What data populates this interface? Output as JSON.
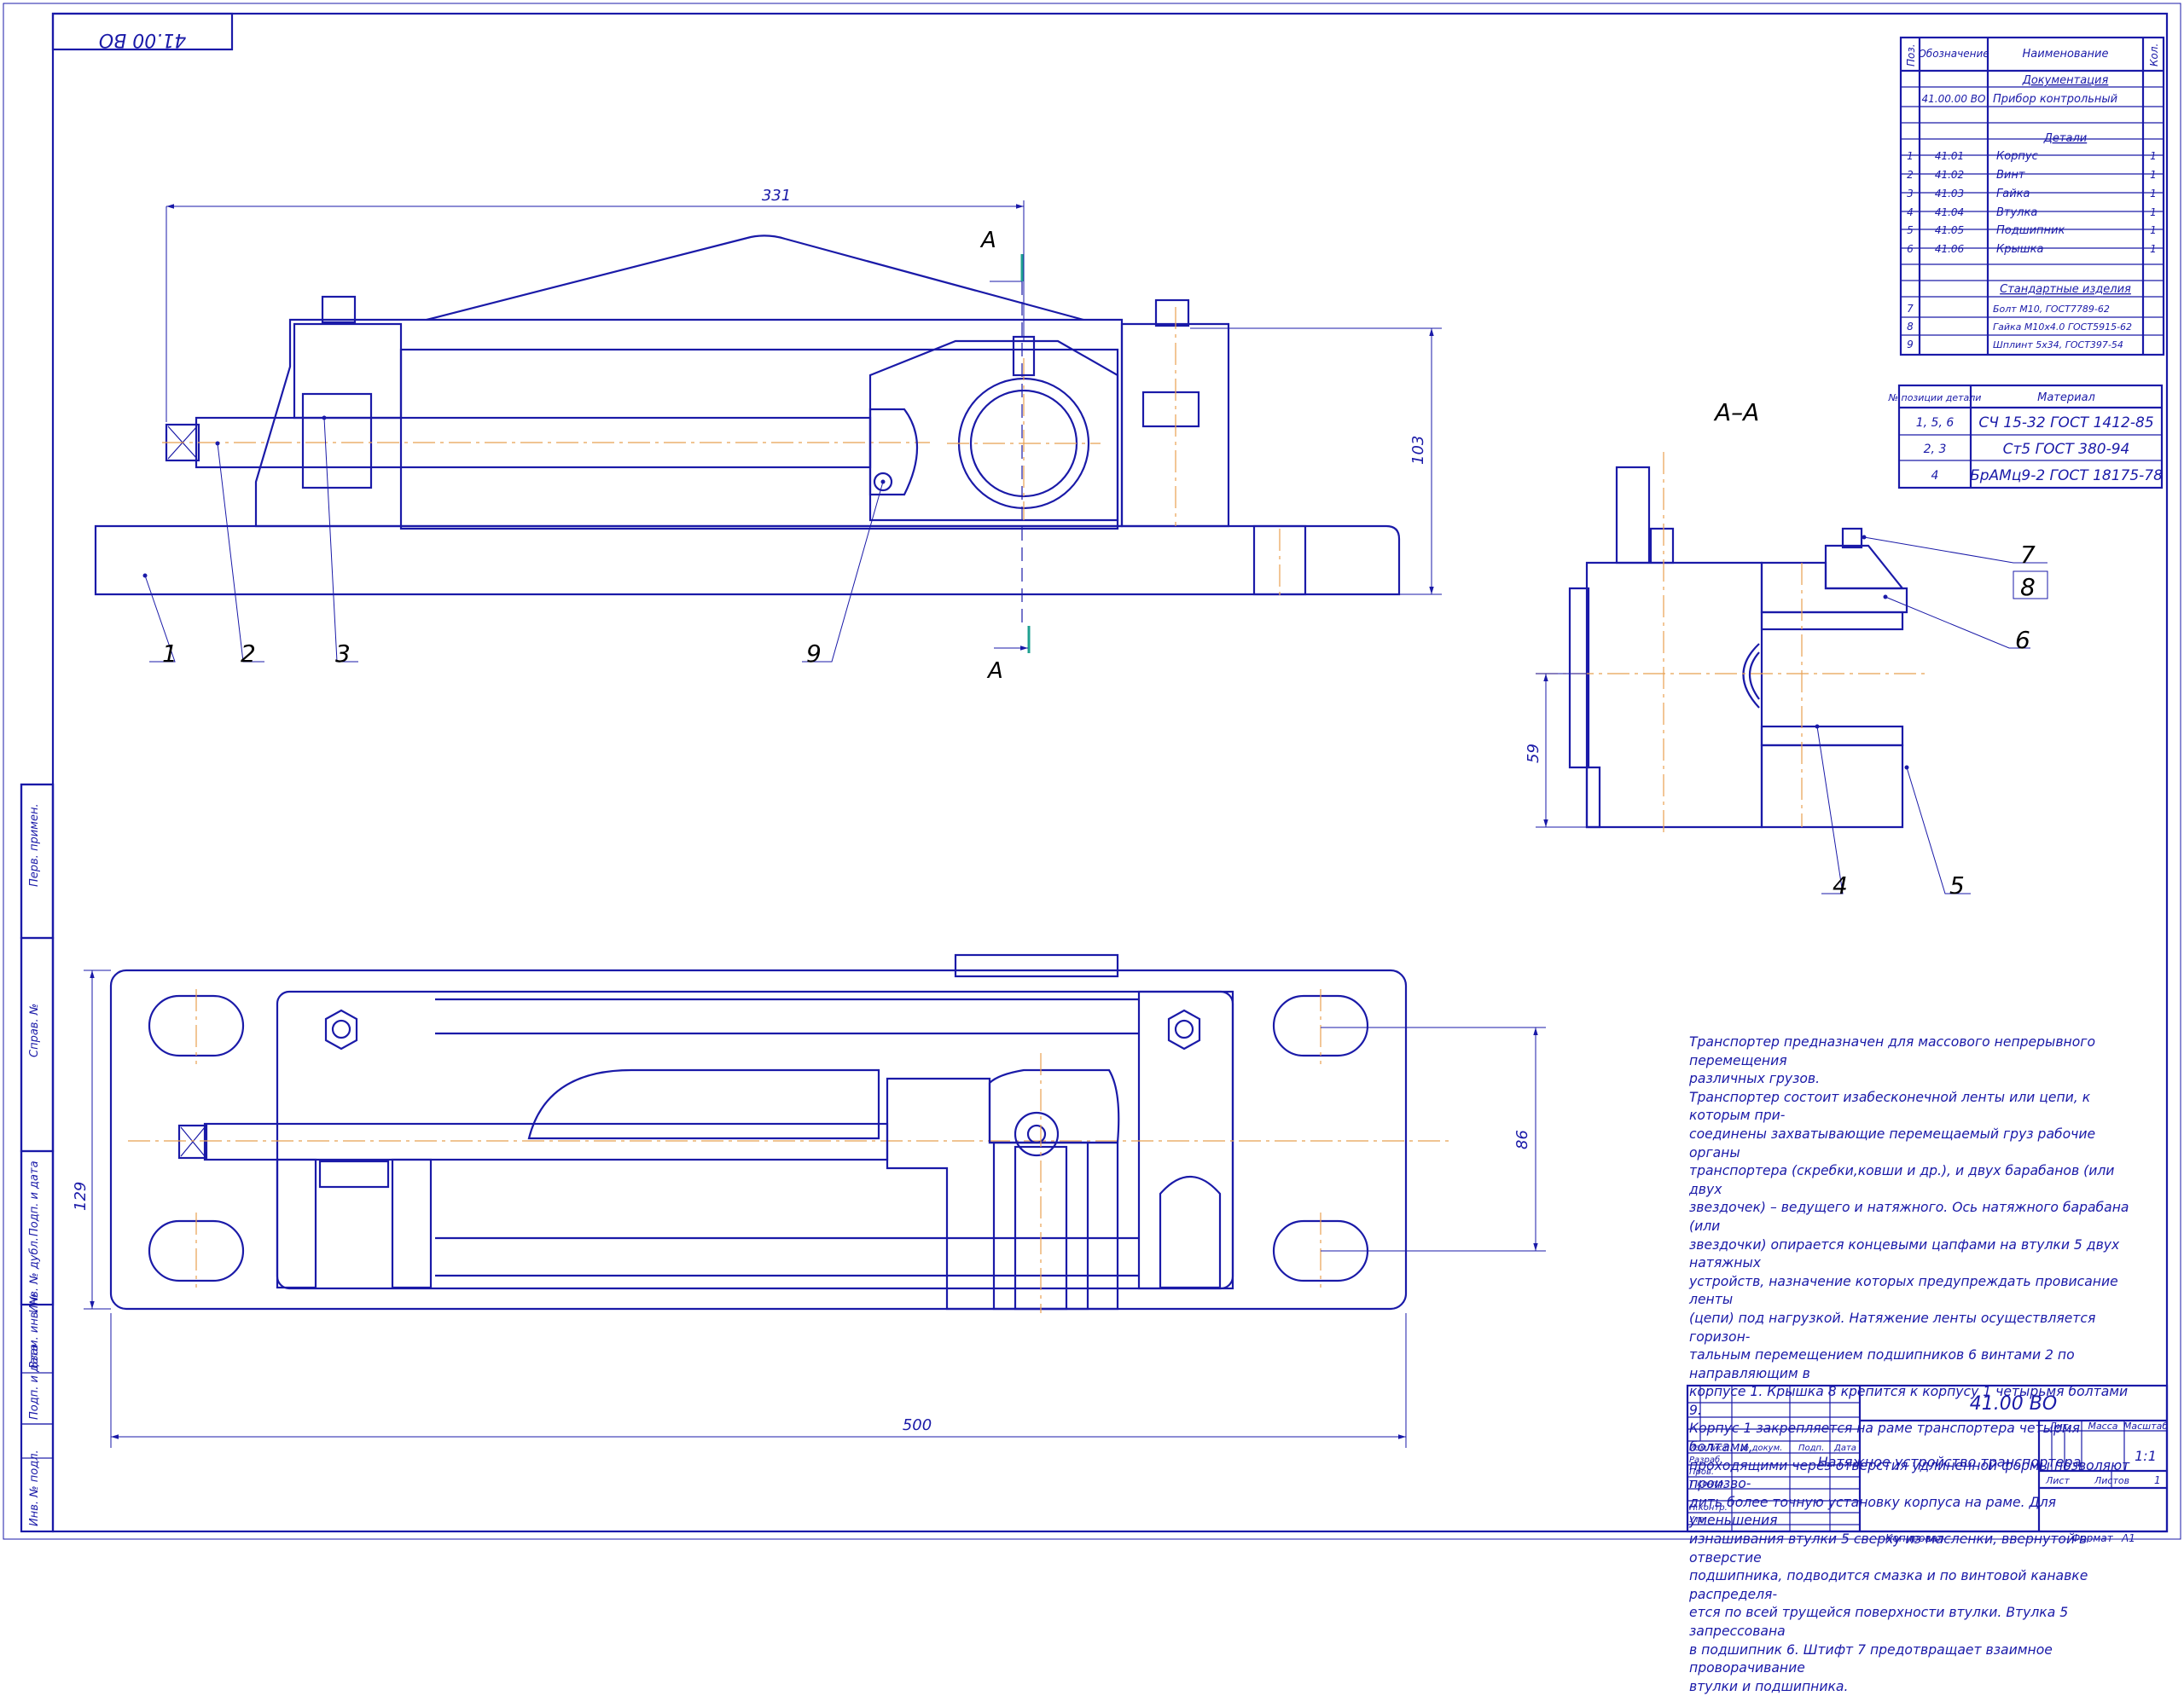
{
  "stamp_top": "41.00 ВО",
  "dimensions": {
    "d331": "331",
    "d103": "103",
    "d59": "59",
    "d129": "129",
    "d86": "86",
    "d500": "500"
  },
  "section_marks": {
    "a1": "А",
    "a2": "А",
    "view_title": "А–А"
  },
  "callouts": {
    "c1": "1",
    "c2": "2",
    "c3": "3",
    "c9": "9",
    "c4": "4",
    "c5": "5",
    "c6": "6",
    "c7": "7",
    "c8": "8"
  },
  "spec_table": {
    "headers": {
      "pos": "Поз.",
      "designation": "Обозначение",
      "name": "Наименование",
      "qty": "Кол."
    },
    "sections": {
      "docs": "Документация",
      "parts": "Детали",
      "std": "Стандартные изделия"
    },
    "doc_row": {
      "designation": "41.00.00 ВО",
      "name": "Прибор контрольный"
    },
    "rows": [
      {
        "pos": "1",
        "designation": "41.01",
        "name": "Корпус",
        "qty": "1"
      },
      {
        "pos": "2",
        "designation": "41.02",
        "name": "Винт",
        "qty": "1"
      },
      {
        "pos": "3",
        "designation": "41.03",
        "name": "Гайка",
        "qty": "1"
      },
      {
        "pos": "4",
        "designation": "41.04",
        "name": "Втулка",
        "qty": "1"
      },
      {
        "pos": "5",
        "designation": "41.05",
        "name": "Подшипник",
        "qty": "1"
      },
      {
        "pos": "6",
        "designation": "41.06",
        "name": "Крышка",
        "qty": "1"
      }
    ],
    "std_rows": [
      {
        "pos": "7",
        "name": "Болт М10, ГОСТ7789-62"
      },
      {
        "pos": "8",
        "name": "Гайка М10х4.0 ГОСТ5915-62"
      },
      {
        "pos": "9",
        "name": "Шплинт 5х34, ГОСТ397-54"
      }
    ]
  },
  "material_table": {
    "headers": {
      "pos": "№ позиции детали",
      "material": "Материал"
    },
    "rows": [
      {
        "pos": "1, 5, 6",
        "material": "СЧ 15-32 ГОСТ 1412-85"
      },
      {
        "pos": "2, 3",
        "material": "Ст5 ГОСТ 380-94"
      },
      {
        "pos": "4",
        "material": "БрАМц9-2 ГОСТ 18175-78"
      }
    ]
  },
  "note_lines": [
    "Транспортер предназначен для массового непрерывного перемещения",
    "различных грузов.",
    "Транспортер состоит изабесконечной ленты или цепи, к которым при-",
    "соединены захватывающие перемещаемый груз рабочие органы",
    "транспортера (скребки,ковши и др.), и двух барабанов (или двух",
    "звездочек) – ведущего и натяжного. Ось натяжного барабана (или",
    "звездочки) опирается концевыми цапфами на втулки 5 двух натяжных",
    "устройств, назначение которых предупреждать провисание ленты",
    "(цепи) под нагрузкой. Натяжение ленты осуществляется горизон-",
    "тальным перемещением подшипников 6 винтами 2 по направляющим в",
    "корпусе 1. Крышка 8 крепится к корпусу 1 четырьмя болтами 9.",
    "Корпус 1 закрепляется на раме транспортера четырмя болтами,",
    "проходящими через отверстия удлиненной формы позволяют произво-",
    "дить более точную установку корпуса на раме. Для уменьшения",
    "изнашивания втулки 5 сверху из масленки, ввернутой в отверстие",
    "подшипника, подводится смазка и по винтовой канавке распределя-",
    "ется по всей трущейся поверхности втулки. Втулка 5 запрессована",
    "в подшипник 6. Штифт 7 предотвращает взаимное проворачивание",
    "втулки и подшипника."
  ],
  "title_block": {
    "code": "41.00 ВО",
    "name": "Натяжное устройство транспортера",
    "lit": "Лит.",
    "mass": "Масса",
    "scale": "Масштаб",
    "scale_value": "1:1",
    "sheet": "Лист",
    "sheets": "Листов",
    "sheets_value": "1",
    "cols": [
      "Изм.",
      "Лист",
      "№ докум.",
      "Подп.",
      "Дата"
    ],
    "roles": [
      "Разраб.",
      "Пров.",
      "Т.контр.",
      "",
      "Н.контр.",
      "Утв."
    ],
    "copied": "Копировал",
    "format": "Формат",
    "format_value": "А1"
  },
  "side_labels": [
    "Перв. примен.",
    "Справ. №",
    "Подп. и дата",
    "Инв. № дубл.",
    "Взам. инв. №",
    "Подп. и дата",
    "Инв. № подл."
  ]
}
